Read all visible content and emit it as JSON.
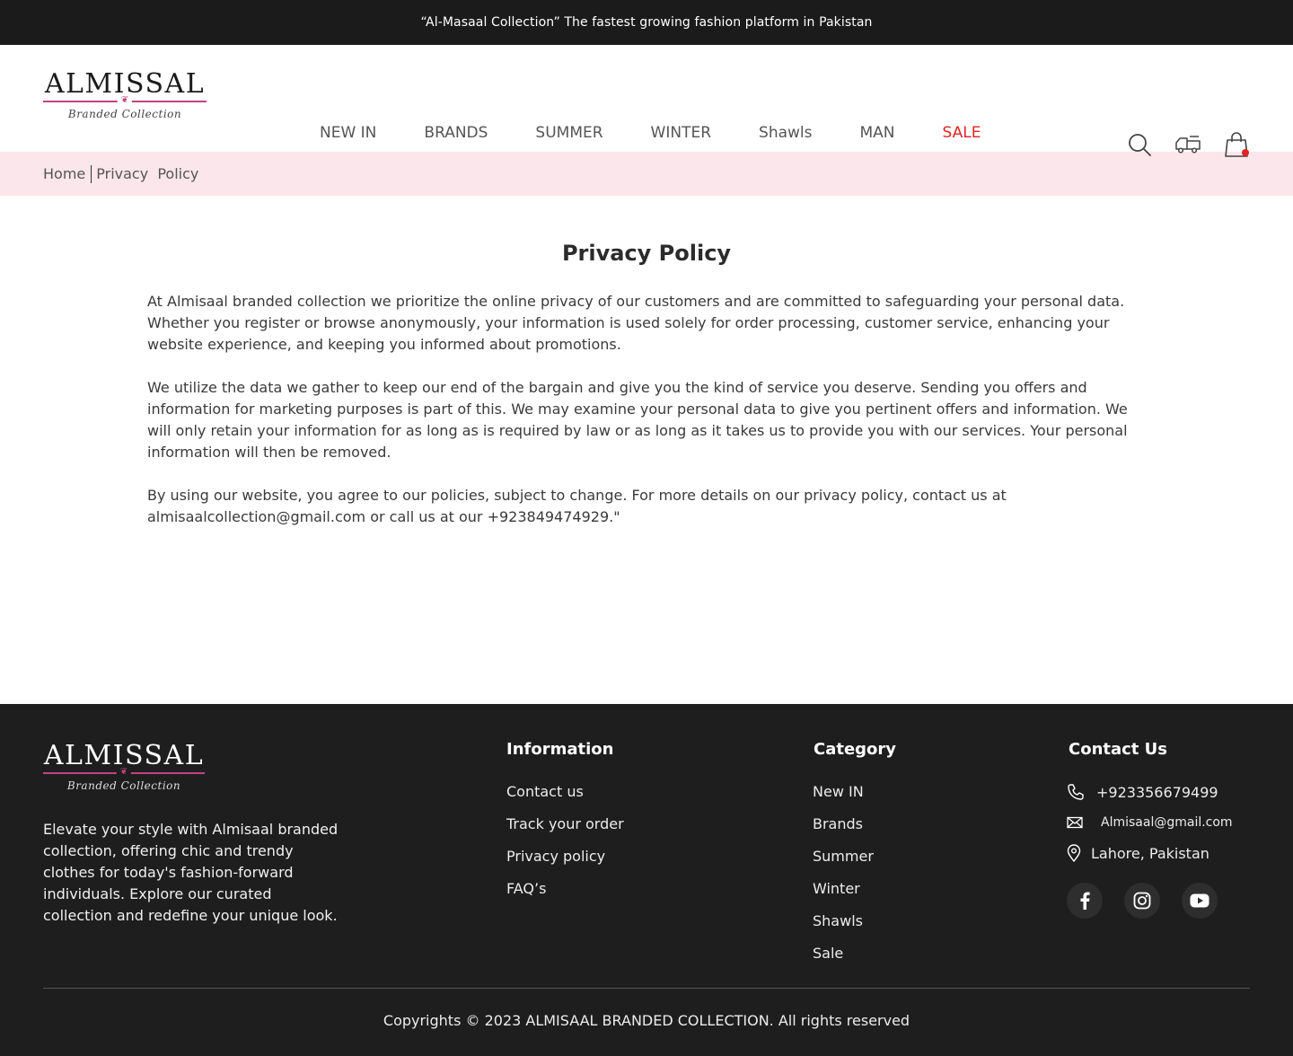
{
  "topbar": {
    "announcement": "“Al-Masaal Collection” The fastest growing fashion platform in Pakistan"
  },
  "brand": {
    "name": "ALMISSAL",
    "tagline": "Branded Collection"
  },
  "nav": [
    "NEW IN",
    "BRANDS",
    "SUMMER",
    "WINTER",
    "Shawls",
    "MAN",
    "SALE"
  ],
  "icons": {
    "search": "search-icon",
    "track": "truck-icon",
    "cart": "shopping-bag-icon"
  },
  "colors": {
    "sale": "#e02424",
    "breadcrumb_bg": "#fbe6eb",
    "footer_bg": "#1e1e1e",
    "logo_accent": "#c2427e"
  },
  "breadcrumb": {
    "home": "Home",
    "current": "Privacy  Policy"
  },
  "page": {
    "title": "Privacy Policy",
    "paragraphs": [
      "At Almisaal branded collection we prioritize the online privacy of our customers and are committed to safeguarding your personal data. Whether you register or browse anonymously, your information is used solely for order processing, customer service, enhancing your website experience, and keeping you informed about promotions.",
      "We utilize the data we gather to keep our end of the bargain and give you the kind of service you deserve. Sending you offers and information for marketing purposes is part of this. We may examine your personal data to give you pertinent offers and information. We will only retain your information for as long as is required by law or as long as it takes us to provide you with our services. Your personal information will then be removed.",
      "By using our website, you agree to our policies, subject to change. For more details on our privacy policy, contact us at almisaalcollection@gmail.com or call us at our +923849474929.\""
    ]
  },
  "footer": {
    "about": "Elevate your style with Almisaal branded collection, offering chic and trendy clothes for today's fashion-forward individuals. Explore our curated collection and redefine your unique look.",
    "information": {
      "title": "Information",
      "links": [
        "Contact us",
        "Track your order",
        "Privacy policy",
        "FAQ’s"
      ]
    },
    "category": {
      "title": "Category",
      "links": [
        "New IN",
        "Brands",
        "Summer",
        "Winter",
        "Shawls",
        "Sale"
      ]
    },
    "contact": {
      "title": "Contact Us",
      "phone": "+923356679499",
      "email": "Almisaal@gmail.com",
      "location": "Lahore, Pakistan",
      "socials": [
        "facebook-icon",
        "instagram-icon",
        "youtube-icon"
      ]
    },
    "copyright": "Copyrights © 2023 ALMISAAL BRANDED COLLECTION. All rights reserved"
  }
}
